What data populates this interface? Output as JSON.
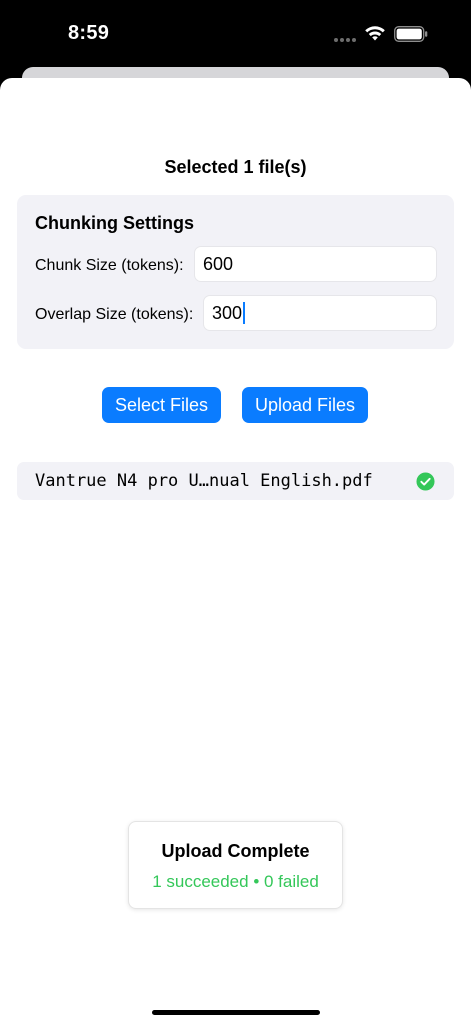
{
  "status_bar": {
    "time": "8:59"
  },
  "header": {
    "selected_count": "Selected 1 file(s)"
  },
  "chunking": {
    "title": "Chunking Settings",
    "chunk_size_label": "Chunk Size (tokens):",
    "chunk_size_value": "600",
    "overlap_size_label": "Overlap Size (tokens):",
    "overlap_size_value": "300"
  },
  "actions": {
    "select_files_label": "Select Files",
    "upload_files_label": "Upload Files"
  },
  "files": [
    {
      "name": "Vantrue N4 pro U…nual English.pdf",
      "status_icon": "check-circle-icon",
      "status_color": "#34c759"
    }
  ],
  "toast": {
    "title": "Upload Complete",
    "summary": "1 succeeded • 0 failed",
    "summary_color": "#34c759"
  },
  "colors": {
    "accent": "#0a7cff",
    "success": "#34c759",
    "card_background": "#f2f2f7"
  }
}
